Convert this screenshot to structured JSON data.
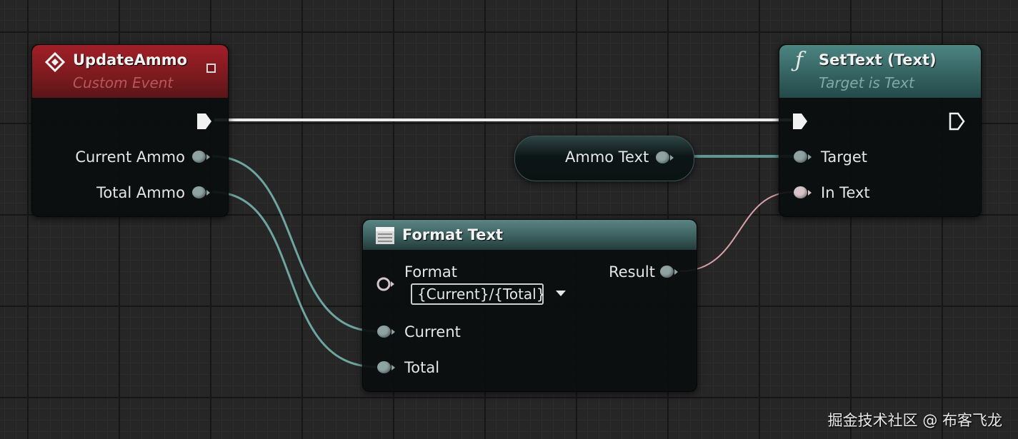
{
  "update_ammo": {
    "title": "UpdateAmmo",
    "subtitle": "Custom Event",
    "outputs": [
      "Current Ammo",
      "Total Ammo"
    ]
  },
  "set_text": {
    "title": "SetText (Text)",
    "subtitle": "Target is Text",
    "inputs": [
      "Target",
      "In Text"
    ]
  },
  "ammo_text": {
    "label": "Ammo Text"
  },
  "format_text": {
    "title": "Format Text",
    "format_label": "Format",
    "format_value": "{Current}/{Total}",
    "result_label": "Result",
    "inputs": [
      "Current",
      "Total"
    ]
  },
  "watermark": "掘金技术社区 @ 布客飞龙",
  "colors": {
    "event_header": "#8a1c22",
    "function_header": "#3f6e6c",
    "pure_header": "#3c5e5c",
    "exec_wire": "#ececec",
    "data_wire": "#6ea5a0",
    "text_wire": "#d9a2a8"
  }
}
